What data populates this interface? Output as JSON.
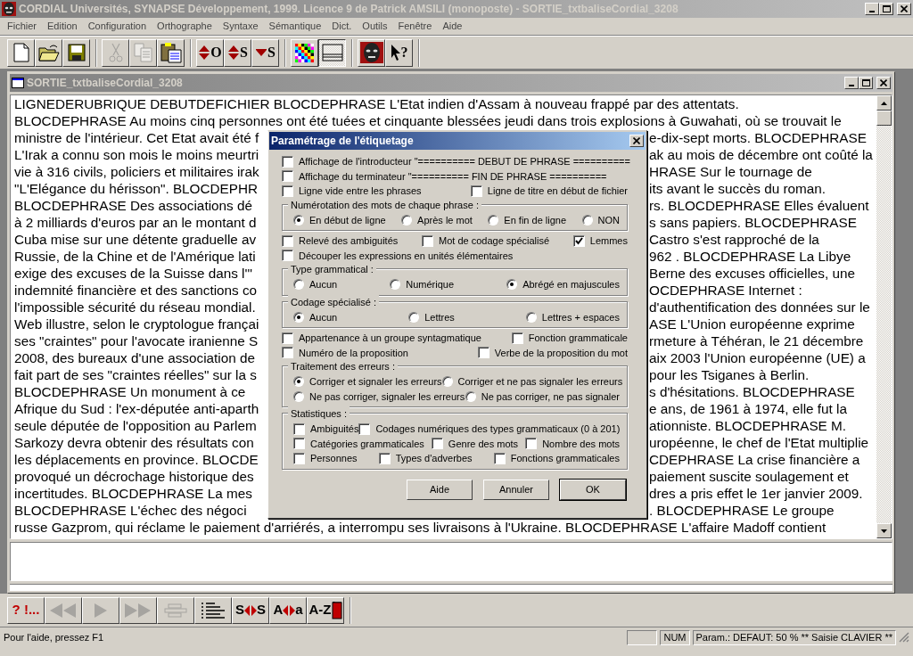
{
  "window": {
    "title": "CORDIAL Universités, SYNAPSE Développement, 1999. Licence 9 de Patrick AMSILI (monoposte) - SORTIE_txtbaliseCordial_3208"
  },
  "menu": [
    "Fichier",
    "Edition",
    "Configuration",
    "Orthographe",
    "Syntaxe",
    "Sémantique",
    "Dict.",
    "Outils",
    "Fenêtre",
    "Aide"
  ],
  "toolbar": [
    [
      {
        "kind": "new",
        "disabled": false,
        "pressed": false
      },
      {
        "kind": "open",
        "disabled": false,
        "pressed": false
      },
      {
        "kind": "save",
        "disabled": false,
        "pressed": false
      }
    ],
    [
      {
        "kind": "cut",
        "disabled": true,
        "pressed": false
      },
      {
        "kind": "copy",
        "disabled": true,
        "pressed": false
      },
      {
        "kind": "paste",
        "disabled": false,
        "pressed": false
      }
    ],
    [
      {
        "kind": "both-arrows",
        "label": "O",
        "disabled": false,
        "pressed": false
      },
      {
        "kind": "both-arrows",
        "label": "S",
        "disabled": false,
        "pressed": false
      },
      {
        "kind": "down-arrow",
        "label": "S",
        "disabled": false,
        "pressed": false
      }
    ],
    [
      {
        "kind": "color-grid",
        "disabled": false,
        "pressed": false
      },
      {
        "kind": "panes",
        "disabled": false,
        "pressed": true
      }
    ],
    [
      {
        "kind": "mask",
        "disabled": false,
        "pressed": false
      },
      {
        "kind": "help-pointer",
        "label": "?",
        "disabled": false,
        "pressed": false
      }
    ]
  ],
  "document": {
    "title": "SORTIE_txtbaliseCordial_3208",
    "lines": [
      {
        "full": "LIGNEDERUBRIQUE DEBUTDEFICHIER BLOCDEPHRASE L'Etat indien d'Assam à nouveau frappé par des attentats."
      },
      {
        "full": "BLOCDEPHRASE Au moins cinq personnes ont été tuées et cinquante blessées jeudi dans trois explosions à Guwahati, où se trouvait le"
      },
      {
        "left": "ministre de l'intérieur. Cet Etat avait été f",
        "right": "e-dix-sept morts. BLOCDEPHRASE"
      },
      {
        "left": "L'Irak a connu son mois le moins meurtri",
        "right": "ak au mois de décembre ont coûté la"
      },
      {
        "left": "vie à 316 civils, policiers et militaires irak",
        "right": "HRASE Sur le tournage de"
      },
      {
        "left": "\"L'Elégance du hérisson\". BLOCDEPHR",
        "right": "its avant le succès du roman."
      },
      {
        "left": "BLOCDEPHRASE Des associations dé",
        "right": "rs. BLOCDEPHRASE Elles évaluent"
      },
      {
        "left": "à 2 milliards d'euros par an le montant d",
        "right": "s sans papiers. BLOCDEPHRASE"
      },
      {
        "left": "Cuba mise sur une détente graduelle av",
        "right": "Castro s'est rapproché de la"
      },
      {
        "left": "Russie, de la Chine et de l'Amérique lati",
        "right": "962 . BLOCDEPHRASE La Libye"
      },
      {
        "left": "exige des excuses de la Suisse dans l'\"",
        "right": "Berne des excuses officielles, une"
      },
      {
        "left": "indemnité financière et des sanctions co",
        "right": "OCDEPHRASE Internet :"
      },
      {
        "left": "l'impossible sécurité du réseau mondial.",
        "right": "d'authentification des données sur le"
      },
      {
        "left": "Web illustre, selon le cryptologue françai",
        "right": "ASE L'Union européenne exprime"
      },
      {
        "left": "ses \"craintes\" pour l'avocate iranienne S",
        "right": "rmeture à Téhéran, le 21 décembre"
      },
      {
        "left": "2008, des bureaux d'une association de",
        "right": "aix 2003 l'Union européenne (UE) a"
      },
      {
        "left": "fait part de ses \"craintes réelles\" sur la s",
        "right": "pour les Tsiganes à Berlin."
      },
      {
        "left": "BLOCDEPHRASE Un monument à ce",
        "right": "s d'hésitations. BLOCDEPHRASE"
      },
      {
        "left": "Afrique du Sud : l'ex-députée anti-aparth",
        "right": "e ans, de 1961 à 1974, elle fut la"
      },
      {
        "left": "seule députée de l'opposition au Parlem",
        "right": "ationniste. BLOCDEPHRASE M."
      },
      {
        "left": "Sarkozy devra obtenir des résultats con",
        "right": "uropéenne, le chef de l'Etat multiplie"
      },
      {
        "left": "les déplacements en province. BLOCDE",
        "right": "CDEPHRASE La crise financière a"
      },
      {
        "left": "provoqué un décrochage historique des",
        "right": "paiement suscite soulagement et"
      },
      {
        "left": "incertitudes. BLOCDEPHRASE La mes",
        "right": "dres a pris effet le 1er janvier 2009."
      },
      {
        "left": "BLOCDEPHRASE L'échec des négoci",
        "right": ". BLOCDEPHRASE Le groupe"
      },
      {
        "full": "russe Gazprom, qui réclame le paiement d'arriérés, a interrompu ses livraisons à l'Ukraine. BLOCDEPHRASE L'affaire Madoff contient"
      }
    ]
  },
  "dialog": {
    "title": "Paramétrage de l'étiquetage",
    "sections": [
      {
        "kind": "checks",
        "items": [
          {
            "label": "Affichage de l'introducteur \"========== DEBUT DE PHRASE ==========",
            "checked": false
          }
        ]
      },
      {
        "kind": "checks",
        "items": [
          {
            "label": "Affichage du terminateur \"========== FIN DE PHRASE ==========",
            "checked": false
          }
        ]
      },
      {
        "kind": "checks",
        "items": [
          {
            "label": "Ligne vide entre les phrases",
            "checked": false
          },
          {
            "label": "Ligne de titre en début de fichier",
            "checked": false
          }
        ]
      },
      {
        "kind": "radios",
        "title": "Numérotation des mots de chaque phrase :",
        "rows": [
          [
            {
              "label": "En début de ligne",
              "selected": true
            },
            {
              "label": "Après le mot",
              "selected": false
            },
            {
              "label": "En fin de ligne",
              "selected": false
            },
            {
              "label": "NON",
              "selected": false
            }
          ]
        ]
      },
      {
        "kind": "checks",
        "items": [
          {
            "label": "Relevé des ambiguités",
            "checked": false
          },
          {
            "label": "Mot de codage spécialisé",
            "checked": false
          },
          {
            "label": "Lemmes",
            "checked": true
          }
        ]
      },
      {
        "kind": "checks",
        "items": [
          {
            "label": "Découper les expressions en unités élémentaires",
            "checked": false
          }
        ]
      },
      {
        "kind": "radios",
        "title": "Type grammatical :",
        "rows": [
          [
            {
              "label": "Aucun",
              "selected": false
            },
            {
              "label": "Numérique",
              "selected": false
            },
            {
              "label": "Abrégé en majuscules",
              "selected": true
            }
          ]
        ]
      },
      {
        "kind": "radios",
        "title": "Codage spécialisé :",
        "rows": [
          [
            {
              "label": "Aucun",
              "selected": true
            },
            {
              "label": "Lettres",
              "selected": false
            },
            {
              "label": "Lettres + espaces",
              "selected": false
            }
          ]
        ]
      },
      {
        "kind": "checks",
        "items": [
          {
            "label": "Appartenance à un groupe syntagmatique",
            "checked": false
          },
          {
            "label": "Fonction grammaticale",
            "checked": false
          }
        ]
      },
      {
        "kind": "checks",
        "items": [
          {
            "label": "Numéro de la proposition",
            "checked": false
          },
          {
            "label": "Verbe de la proposition du mot",
            "checked": false
          }
        ]
      },
      {
        "kind": "radios",
        "title": "Traitement des erreurs :",
        "rows": [
          [
            {
              "label": "Corriger et signaler les erreurs",
              "selected": true
            },
            {
              "label": "Corriger et ne pas signaler les erreurs",
              "selected": false
            }
          ],
          [
            {
              "label": "Ne pas corriger, signaler les erreurs",
              "selected": false
            },
            {
              "label": "Ne pas corriger, ne pas signaler",
              "selected": false
            }
          ]
        ]
      },
      {
        "kind": "checkgroup",
        "title": "Statistiques :",
        "rows": [
          [
            {
              "label": "Ambiguités",
              "checked": false
            },
            {
              "label": "Codages numériques des types grammaticaux (0 à 201)",
              "checked": false
            }
          ],
          [
            {
              "label": "Catégories grammaticales",
              "checked": false
            },
            {
              "label": "Genre des mots",
              "checked": false
            },
            {
              "label": "Nombre des mots",
              "checked": false
            }
          ],
          [
            {
              "label": "Personnes",
              "checked": false
            },
            {
              "label": "Types d'adverbes",
              "checked": false
            },
            {
              "label": "Fonctions grammaticales",
              "checked": false
            }
          ]
        ]
      }
    ],
    "buttons": [
      {
        "label": "Aide",
        "default": false
      },
      {
        "label": "Annuler",
        "default": false
      },
      {
        "label": "OK",
        "default": true
      }
    ]
  },
  "bottom_toolbar": [
    {
      "kind": "errors",
      "label": "? !...",
      "disabled": false
    },
    {
      "kind": "rewind",
      "disabled": true
    },
    {
      "kind": "play",
      "disabled": true
    },
    {
      "kind": "forward",
      "disabled": true
    },
    {
      "kind": "outline",
      "disabled": true
    },
    {
      "kind": "list",
      "disabled": false
    },
    {
      "kind": "swap",
      "left": "S",
      "right": "S",
      "disabled": false
    },
    {
      "kind": "swap",
      "left": "A",
      "right": "a",
      "disabled": false
    },
    {
      "kind": "dictionary",
      "label": "A-Z",
      "disabled": false
    }
  ],
  "status_bar": {
    "message": "Pour l'aide, pressez F1",
    "panels": [
      "NUM",
      "Param.: DEFAUT: 50 % ** Saisie CLAVIER **"
    ]
  }
}
